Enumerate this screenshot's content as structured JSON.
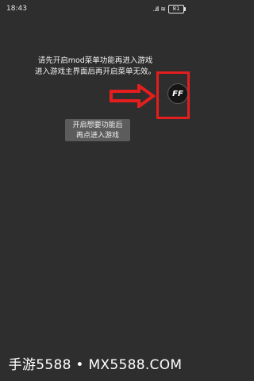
{
  "statusbar": {
    "time": "18:43",
    "signal": "..ıll",
    "wifi": "≋",
    "battery": "81"
  },
  "instructions": {
    "line1": "请先开启mod菜单功能再进入游戏",
    "line2": "进入游戏主界面后再开启菜单无效。"
  },
  "mod_button": {
    "label": "FF"
  },
  "hint": {
    "line1": "开启想要功能后",
    "line2": "再点进入游戏"
  },
  "watermark": {
    "text": "手游5588 • MX5588.COM"
  },
  "colors": {
    "annotation_red": "#e41e1e",
    "background": "#2e2e2e"
  }
}
